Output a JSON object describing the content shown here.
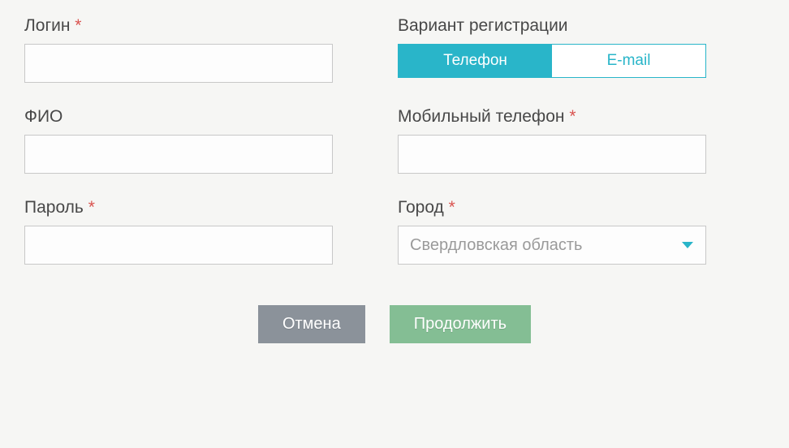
{
  "left": {
    "login": {
      "label": "Логин",
      "required": true,
      "value": ""
    },
    "fio": {
      "label": "ФИО",
      "required": false,
      "value": ""
    },
    "password": {
      "label": "Пароль",
      "required": true,
      "value": ""
    }
  },
  "right": {
    "reg_variant": {
      "label": "Вариант регистрации"
    },
    "toggle": {
      "phone": "Телефон",
      "email": "E-mail",
      "active": "phone"
    },
    "mobile": {
      "label": "Мобильный телефон",
      "required": true,
      "value": ""
    },
    "city": {
      "label": "Город",
      "required": true,
      "selected": "Свердловская область"
    }
  },
  "buttons": {
    "cancel": "Отмена",
    "submit": "Продолжить"
  },
  "required_marker": "*"
}
